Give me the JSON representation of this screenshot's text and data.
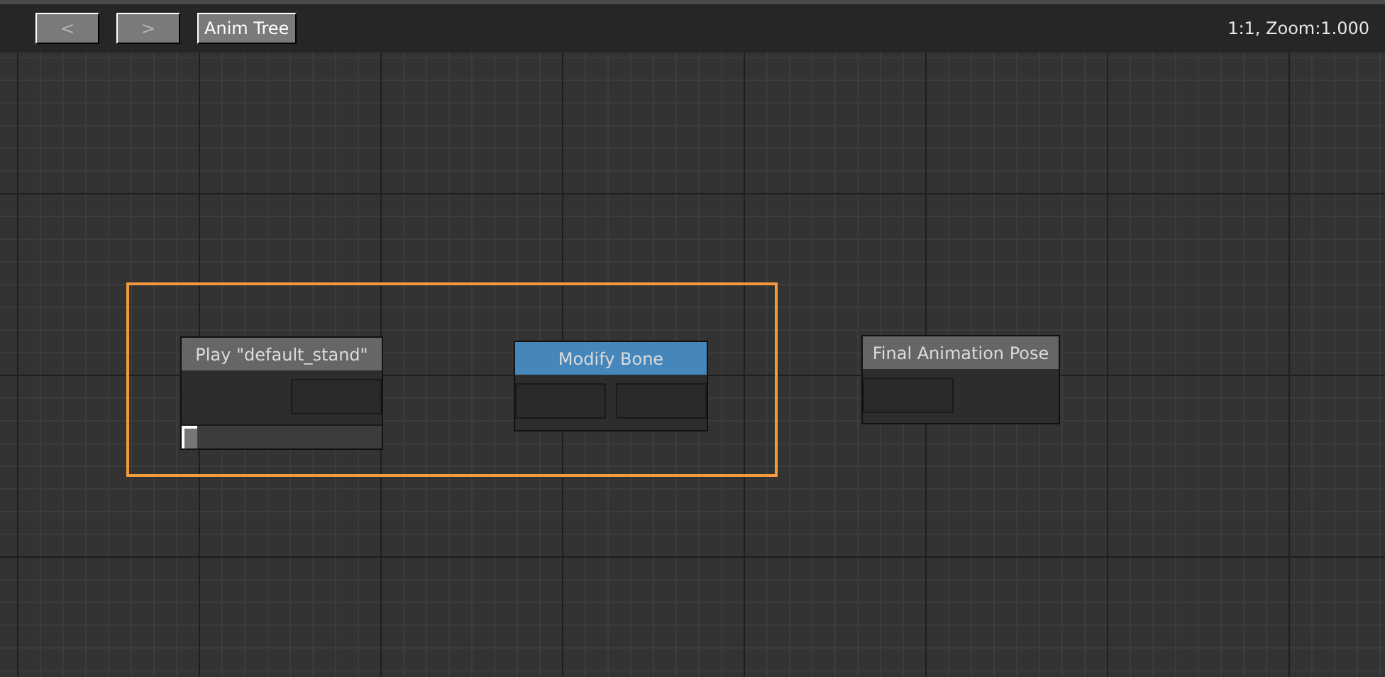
{
  "toolbar": {
    "buttons": [
      {
        "label": "<",
        "disabled": true
      },
      {
        "label": ">",
        "disabled": true
      },
      {
        "label": "Anim Tree",
        "disabled": false
      }
    ],
    "status": "1:1, Zoom:1.000"
  },
  "nodes": [
    {
      "kind": "play",
      "title": "Play \"default_stand\"",
      "selected": false,
      "level": 0
    },
    {
      "kind": "modify",
      "title": "Modify Bone",
      "selected": true
    },
    {
      "kind": "output",
      "title": "Final Animation Pose",
      "selected": false
    }
  ]
}
